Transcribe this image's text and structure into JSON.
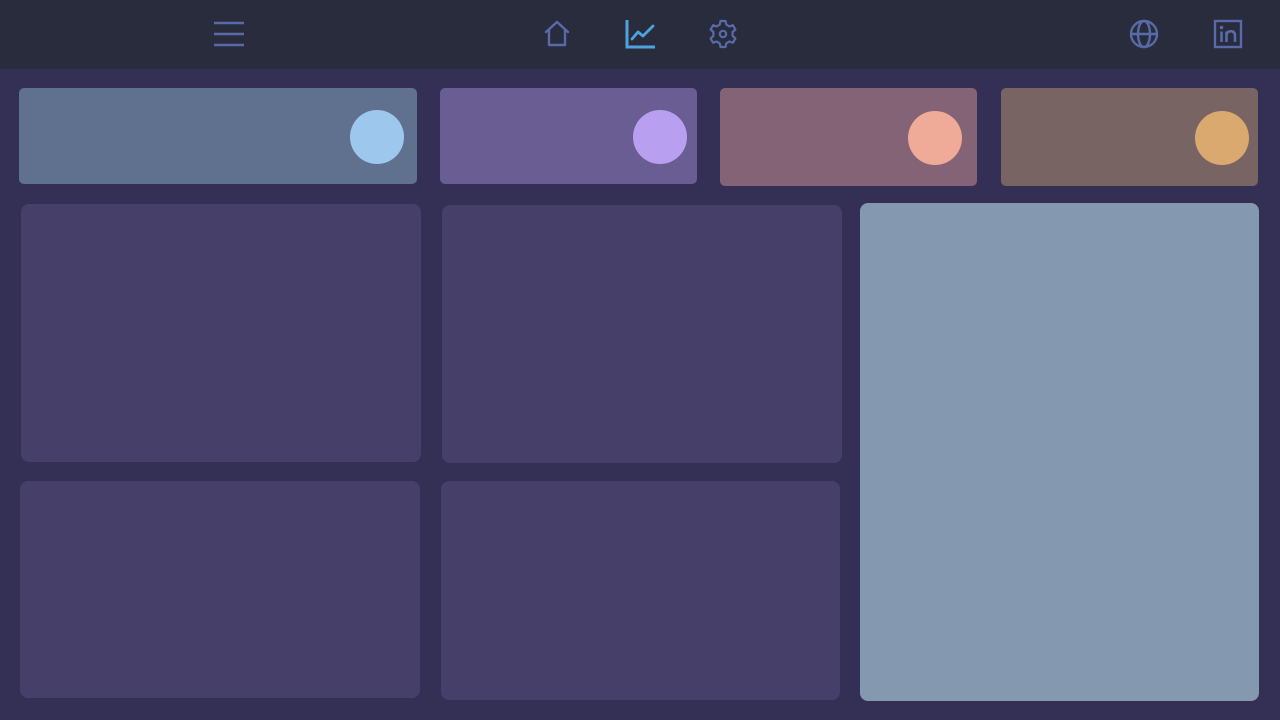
{
  "topbar": {
    "background": "#282c3c",
    "icons": {
      "menu": "menu-icon",
      "home": "home-icon",
      "analytics": "line-chart-icon",
      "settings": "gear-icon",
      "website": "globe-icon",
      "linkedin": "linkedin-icon"
    },
    "active_item": "analytics",
    "icon_color": "#5a6aa8",
    "active_color": "#4fa3dc"
  },
  "stat_cards": [
    {
      "card_color": "#60718f",
      "circle_color": "#9ec7ee"
    },
    {
      "card_color": "#6a5d93",
      "circle_color": "#b89ff0"
    },
    {
      "card_color": "#856376",
      "circle_color": "#efaa98"
    },
    {
      "card_color": "#786463",
      "circle_color": "#d9a970"
    }
  ],
  "panels": {
    "default_color": "#463f69",
    "side_panel_color": "#8499b0"
  },
  "page_background": "#342f55"
}
